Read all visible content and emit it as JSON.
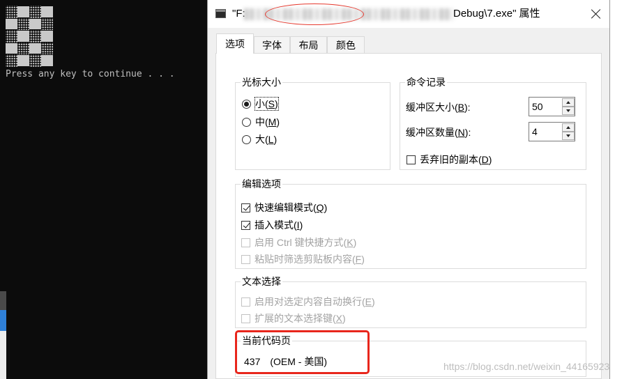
{
  "console": {
    "message": "Press any key to continue . . ."
  },
  "dialog": {
    "title_prefix": "\"F:",
    "title_suffix": "Debug\\7.exe\" 属性",
    "tabs": [
      {
        "label": "选项",
        "selected": true
      },
      {
        "label": "字体",
        "selected": false
      },
      {
        "label": "布局",
        "selected": false
      },
      {
        "label": "颜色",
        "selected": false
      }
    ],
    "cursor_size": {
      "title": "光标大小",
      "options": [
        {
          "before": "小(",
          "key": "S",
          "after": ")",
          "selected": true
        },
        {
          "before": "中(",
          "key": "M",
          "after": ")",
          "selected": false
        },
        {
          "before": "大(",
          "key": "L",
          "after": ")",
          "selected": false
        }
      ]
    },
    "command_history": {
      "title": "命令记录",
      "buffer_size": {
        "before": "缓冲区大小(",
        "key": "B",
        "after": "):",
        "value": "50"
      },
      "buffer_count": {
        "before": "缓冲区数量(",
        "key": "N",
        "after": "):",
        "value": "4"
      },
      "discard_old": {
        "before": "丢弃旧的副本(",
        "key": "D",
        "after": ")",
        "checked": false
      }
    },
    "edit_options": {
      "title": "编辑选项",
      "items": [
        {
          "before": "快速编辑模式(",
          "key": "Q",
          "after": ")",
          "checked": true,
          "disabled": false
        },
        {
          "before": "插入模式(",
          "key": "I",
          "after": ")",
          "checked": true,
          "disabled": false
        },
        {
          "before": "启用 Ctrl 键快捷方式(",
          "key": "K",
          "after": ")",
          "checked": false,
          "disabled": true
        },
        {
          "before": "粘贴时筛选剪贴板内容(",
          "key": "F",
          "after": ")",
          "checked": false,
          "disabled": true
        }
      ]
    },
    "text_selection": {
      "title": "文本选择",
      "items": [
        {
          "before": "启用对选定内容自动换行(",
          "key": "E",
          "after": ")",
          "checked": false,
          "disabled": true
        },
        {
          "before": "扩展的文本选择键(",
          "key": "X",
          "after": ")",
          "checked": false,
          "disabled": true
        }
      ]
    },
    "code_page": {
      "title": "当前代码页",
      "number": "437",
      "name": "(OEM - 美国)"
    }
  },
  "watermark": "https://blog.csdn.net/weixin_44165923",
  "colors": {
    "console_background": "#0c0c0c",
    "console_text": "#c0c0c0",
    "annotation_red": "#e8261c",
    "dialog_background": "#f0f0f0",
    "taskbar_accent": "#2f80d8"
  }
}
